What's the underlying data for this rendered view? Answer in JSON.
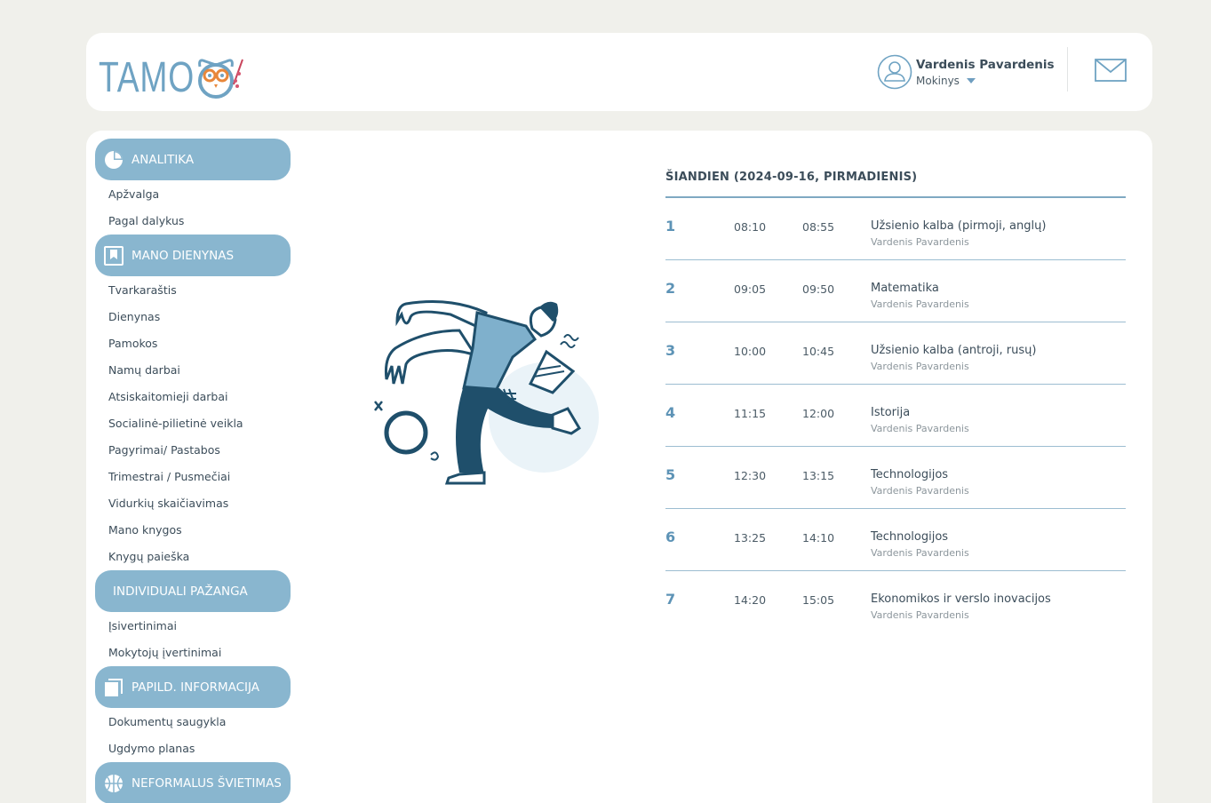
{
  "header": {
    "logo_text": "TAMO",
    "user": {
      "name": "Vardenis Pavardenis",
      "role": "Mokinys"
    },
    "icons": [
      "user-avatar-icon",
      "chevron-down-icon",
      "mail-icon"
    ]
  },
  "sidebar": {
    "sections": [
      {
        "label": "ANALITIKA",
        "icon": "pie-chart-icon",
        "items": [
          "Apžvalga",
          "Pagal dalykus"
        ]
      },
      {
        "label": "MANO DIENYNAS",
        "icon": "bookmark-icon",
        "items": [
          "Tvarkaraštis",
          "Dienynas",
          "Pamokos",
          "Namų darbai",
          "Atsiskaitomieji darbai",
          "Socialinė-pilietinė veikla",
          "Pagyrimai/ Pastabos",
          "Trimestrai / Pusmečiai",
          "Vidurkių skaičiavimas",
          "Mano knygos",
          "Knygų paieška"
        ]
      },
      {
        "label": "INDIVIDUALI PAŽANGA",
        "icon": "",
        "items": [
          "Įsivertinimai",
          "Mokytojų įvertinimai"
        ]
      },
      {
        "label": "PAPILD. INFORMACIJA",
        "icon": "copy-icon",
        "items": [
          "Dokumentų saugykla",
          "Ugdymo planas"
        ]
      },
      {
        "label": "NEFORMALUS ŠVIETIMAS",
        "icon": "basketball-icon",
        "items": []
      }
    ]
  },
  "schedule": {
    "title": "ŠIANDIEN (2024-09-16, PIRMADIENIS)",
    "lessons": [
      {
        "num": "1",
        "start": "08:10",
        "end": "08:55",
        "subject": "Užsienio kalba (pirmoji, anglų)",
        "teacher": "Vardenis Pavardenis"
      },
      {
        "num": "2",
        "start": "09:05",
        "end": "09:50",
        "subject": "Matematika",
        "teacher": "Vardenis Pavardenis"
      },
      {
        "num": "3",
        "start": "10:00",
        "end": "10:45",
        "subject": "Užsienio kalba (antroji, rusų)",
        "teacher": "Vardenis Pavardenis"
      },
      {
        "num": "4",
        "start": "11:15",
        "end": "12:00",
        "subject": "Istorija",
        "teacher": "Vardenis Pavardenis"
      },
      {
        "num": "5",
        "start": "12:30",
        "end": "13:15",
        "subject": "Technologijos",
        "teacher": "Vardenis Pavardenis"
      },
      {
        "num": "6",
        "start": "13:25",
        "end": "14:10",
        "subject": "Technologijos",
        "teacher": "Vardenis Pavardenis"
      },
      {
        "num": "7",
        "start": "14:20",
        "end": "15:05",
        "subject": "Ekonomikos ir verslo inovacijos",
        "teacher": "Vardenis Pavardenis"
      }
    ]
  },
  "colors": {
    "accent": "#89b6cf",
    "number": "#5d93b6",
    "dark_figure": "#1f4f6b",
    "background": "#f0f0eb"
  }
}
